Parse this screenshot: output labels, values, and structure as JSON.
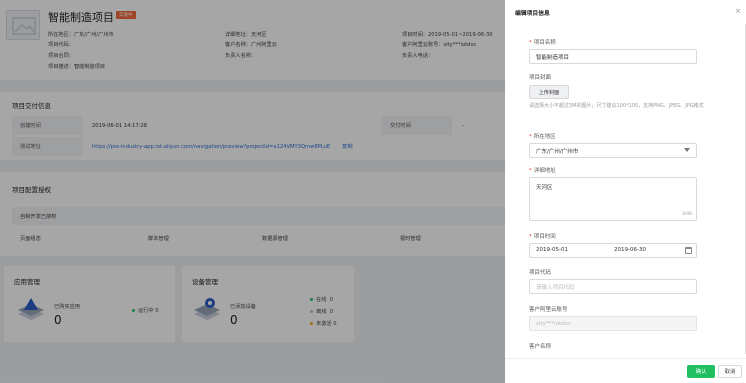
{
  "project": {
    "title": "智能制造项目",
    "tag": "实施中",
    "info_col1": [
      "所在地区：广东/广州/广州市",
      "项目代码：",
      "项目合同：",
      "项目描述：智能制造项目"
    ],
    "info_col2": [
      "详细地址：天河区",
      "客户名称：广州阿里云",
      "负责人名称："
    ],
    "info_col3": [
      "项目时间：2019-05-01~2019-06-30",
      "客户阿里云账号：sity***iotdoc",
      "负责人电话："
    ]
  },
  "delivery": {
    "title": "项目交付信息",
    "created_label": "创建时间",
    "created_value": "2019-06-01 14:17:28",
    "delivered_label": "交付时间",
    "delivered_value": "-",
    "test_label": "测试地址",
    "test_url": "https://pre-industry-app.iot.aliyun.com/navigation/preview?projectId=a124VMY3Qmw8PLuE",
    "copy_label": "复制"
  },
  "permissions": {
    "title": "项目配置授权",
    "authorize_label": "自制开发已授权",
    "columns": [
      "页面组态",
      "脚本管理",
      "数据源管理",
      "视时管理"
    ]
  },
  "apps": {
    "title": "应用管理",
    "purchased_label": "已购买应用",
    "count": "0",
    "running_label": "运行中",
    "running_count": "0"
  },
  "devices": {
    "title": "设备管理",
    "added_label": "已添加设备",
    "count": "0",
    "statuses": [
      {
        "label": "在线",
        "count": "0",
        "color": "#2dbf6b"
      },
      {
        "label": "离线",
        "count": "0",
        "color": "#bfbfbf"
      },
      {
        "label": "未激活",
        "count": "0",
        "color": "#f5a623"
      }
    ]
  },
  "drawer": {
    "title": "编辑项目信息",
    "close_icon": "×",
    "name_label": "项目名称",
    "name_value": "智能制造项目",
    "cover_label": "项目封面",
    "upload_label": "上传封面",
    "cover_hint": "请选择大小不超过5M的图片，尺寸建议100*100，支持PNG、JPEG、JPG格式",
    "region_label": "所在地区",
    "region_value": "广东/广州/广州市",
    "address_label": "详细地址",
    "address_value": "天河区",
    "address_counter": "3/40",
    "time_label": "项目时间",
    "start_date": "2019-05-01",
    "end_date": "2019-06-30",
    "code_label": "项目代码",
    "code_placeholder": "请输入项目代码",
    "account_label": "客户阿里云账号",
    "account_value": "sity***iotdoc",
    "customer_label": "客户名称",
    "ok_label": "确认",
    "cancel_label": "取消"
  }
}
